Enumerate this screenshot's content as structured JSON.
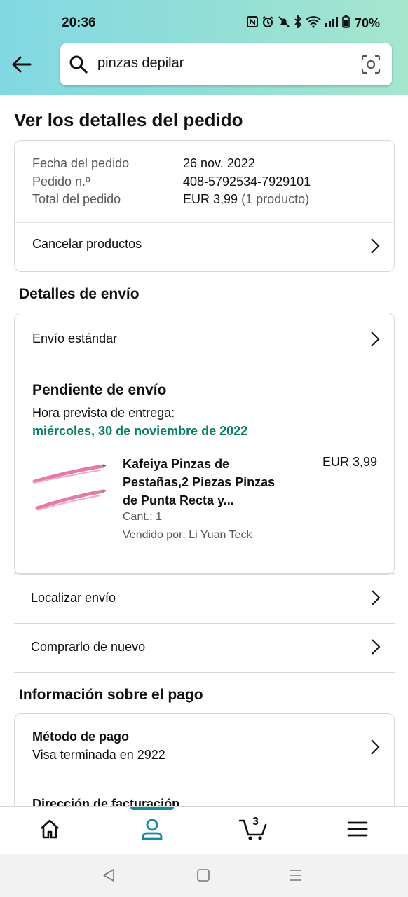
{
  "status_bar": {
    "time": "20:36",
    "battery": "70%"
  },
  "search": {
    "query": "pinzas depilar"
  },
  "page_title": "Ver los detalles del pedido",
  "order_summary": {
    "date_label": "Fecha del pedido",
    "date_value": "26 nov. 2022",
    "number_label": "Pedido n.º",
    "number_value": "408-5792534-7929101",
    "total_label": "Total del pedido",
    "total_value": "EUR 3,99",
    "total_count": "(1 producto)",
    "cancel_label": "Cancelar productos"
  },
  "shipping": {
    "heading": "Detalles de envío",
    "method": "Envío estándar",
    "status": "Pendiente de envío",
    "eta_label": "Hora prevista de entrega:",
    "eta_value": "miércoles, 30 de noviembre de 2022",
    "item": {
      "title_line1": "Kafeiya Pinzas de",
      "title_line2": "Pestañas,2 Piezas Pinzas",
      "title_line3": "de Punta Recta y...",
      "price": "EUR 3,99",
      "qty": "Cant.: 1",
      "seller": "Vendido por: Li Yuan Teck"
    },
    "track_label": "Localizar envío",
    "buy_again_label": "Comprarlo de nuevo"
  },
  "payment": {
    "heading": "Información sobre el pago",
    "method_label": "Método de pago",
    "method_value": "Visa terminada en 2922",
    "billing_label": "Dirección de facturación"
  },
  "bottom_nav": {
    "cart_count": "3",
    "active": "account"
  },
  "colors": {
    "accent": "#148aa0",
    "green": "#067d62",
    "tweezer_pink": "#e67aa6"
  }
}
